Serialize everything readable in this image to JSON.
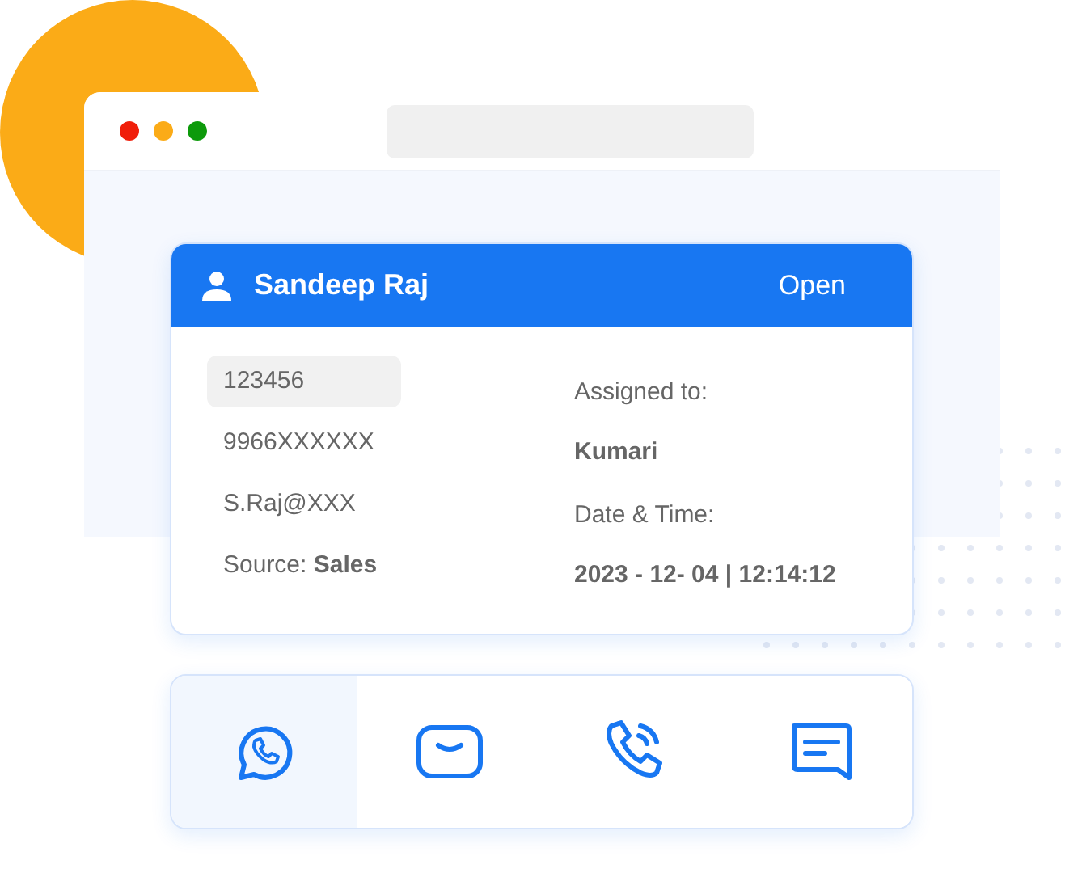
{
  "window": {
    "controls": [
      {
        "color": "#f01e0a"
      },
      {
        "color": "#fbab17"
      },
      {
        "color": "#0d9a0b"
      }
    ]
  },
  "lead_card": {
    "name": "Sandeep Raj",
    "status": "Open",
    "contact_fields": [
      {
        "text": "123456",
        "highlighted": true
      },
      {
        "text": "9966XXXXXX",
        "highlighted": false
      },
      {
        "text": "S.Raj@XXX",
        "highlighted": false
      },
      {
        "text": "Source: **Sales**",
        "highlighted": false
      }
    ],
    "details": [
      {
        "label": "Assigned to:",
        "value": "Kumari"
      },
      {
        "label": "Date & Time:",
        "value": "2023 - 12- 04 | 12:14:12"
      }
    ]
  },
  "channels": [
    {
      "kind": "whatsapp",
      "selected": true
    },
    {
      "kind": "email",
      "selected": false
    },
    {
      "kind": "call",
      "selected": false
    },
    {
      "kind": "sms",
      "selected": false
    }
  ]
}
